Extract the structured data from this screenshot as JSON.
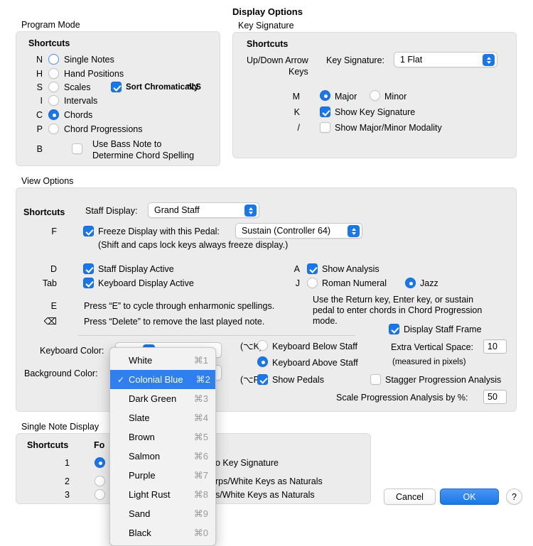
{
  "program_mode": {
    "title": "Program Mode",
    "shortcuts_header": "Shortcuts",
    "options": [
      {
        "key": "N",
        "label": "Single Notes",
        "selected": false
      },
      {
        "key": "H",
        "label": "Hand Positions",
        "selected": false
      },
      {
        "key": "S",
        "label": "Scales",
        "selected": false
      },
      {
        "key": "I",
        "label": "Intervals",
        "selected": false
      },
      {
        "key": "C",
        "label": "Chords",
        "selected": true
      },
      {
        "key": "P",
        "label": "Chord Progressions",
        "selected": false
      }
    ],
    "sort_chromatically": {
      "label": "Sort Chromatically",
      "shortcut": "⌥S",
      "checked": true
    },
    "bass_note": {
      "key": "B",
      "line1": "Use Bass Note to",
      "line2": "Determine Chord Spelling",
      "checked": false
    }
  },
  "display_options": {
    "title": "Display Options",
    "key_signature_group": "Key Signature",
    "shortcuts_header": "Shortcuts",
    "arrow_keys_line1": "Up/Down Arrow",
    "arrow_keys_line2": "Keys",
    "key_signature_label": "Key Signature:",
    "key_signature_value": "1 Flat",
    "modality": {
      "key": "M",
      "major": {
        "label": "Major",
        "selected": true
      },
      "minor": {
        "label": "Minor",
        "selected": false
      }
    },
    "show_key_signature": {
      "key": "K",
      "label": "Show Key Signature",
      "checked": true
    },
    "show_modality": {
      "key": "/",
      "label": "Show Major/Minor Modality",
      "checked": false
    }
  },
  "view_options": {
    "title": "View Options",
    "shortcuts_header": "Shortcuts",
    "staff_display_label": "Staff Display:",
    "staff_display_value": "Grand Staff",
    "freeze": {
      "key": "F",
      "label": "Freeze Display with this Pedal:",
      "checked": true,
      "pedal_value": "Sustain (Controller 64)",
      "note": "(Shift and caps lock keys always freeze display.)"
    },
    "staff_display_active": {
      "key": "D",
      "label": "Staff Display Active",
      "checked": true
    },
    "keyboard_display_active": {
      "key": "Tab",
      "label": "Keyboard Display Active",
      "checked": true
    },
    "enharmonic_hint": {
      "key": "E",
      "text": "Press “E” to cycle through enharmonic spellings."
    },
    "delete_hint": {
      "key": "⌫",
      "text": "Press “Delete” to remove the last played note."
    },
    "show_analysis": {
      "key": "A",
      "label": "Show Analysis",
      "checked": true
    },
    "analysis_style": {
      "key": "J",
      "roman": {
        "label": "Roman Numeral",
        "selected": false
      },
      "jazz": {
        "label": "Jazz",
        "selected": true
      }
    },
    "progression_hint_line1": "Use the Return key, Enter key, or sustain",
    "progression_hint_line2": "pedal to enter chords in Chord Progression",
    "progression_hint_line3": "mode.",
    "display_staff_frame": {
      "label": "Display Staff Frame",
      "checked": true
    },
    "keyboard_color_label": "Keyboard Color:",
    "background_color_label": "Background Color:",
    "keyboard_color_shortcut": "(⌥K)",
    "pedals_shortcut": "(⌥P)",
    "keyboard_below_staff": {
      "label": "Keyboard Below Staff",
      "selected": false
    },
    "keyboard_above_staff": {
      "label": "Keyboard Above Staff",
      "selected": true
    },
    "show_pedals": {
      "label": "Show Pedals",
      "checked": true
    },
    "extra_vertical_space": {
      "label": "Extra Vertical Space:",
      "value": "10",
      "note": "(measured in pixels)"
    },
    "stagger_progression": {
      "label": "Stagger Progression Analysis",
      "checked": false
    },
    "scale_progression": {
      "label": "Scale Progression Analysis by %:",
      "value": "50"
    }
  },
  "color_menu": {
    "items": [
      {
        "label": "White",
        "shortcut": "⌘1",
        "checked": false
      },
      {
        "label": "Colonial Blue",
        "shortcut": "⌘2",
        "checked": true
      },
      {
        "label": "Dark Green",
        "shortcut": "⌘3",
        "checked": false
      },
      {
        "label": "Slate",
        "shortcut": "⌘4",
        "checked": false
      },
      {
        "label": "Brown",
        "shortcut": "⌘5",
        "checked": false
      },
      {
        "label": "Salmon",
        "shortcut": "⌘6",
        "checked": false
      },
      {
        "label": "Purple",
        "shortcut": "⌘7",
        "checked": false
      },
      {
        "label": "Light Rust",
        "shortcut": "⌘8",
        "checked": false
      },
      {
        "label": "Sand",
        "shortcut": "⌘9",
        "checked": false
      },
      {
        "label": "Black",
        "shortcut": "⌘0",
        "checked": false
      }
    ],
    "checkmark": "✓"
  },
  "single_note_display": {
    "title": "Single Note Display",
    "shortcuts_header": "Shortcuts",
    "column_header": "Follow",
    "column_header_visible": "Fo",
    "options": [
      {
        "key": "1",
        "label": "Follow Key Signature",
        "visible_tail": "o Key Signature",
        "selected": true
      },
      {
        "key": "2",
        "label": "Black Keys as Sharps/White Keys as Naturals",
        "visible_tail": "rps/White Keys as Naturals",
        "selected": false
      },
      {
        "key": "3",
        "label": "Black Keys as Flats/White Keys as Naturals",
        "visible_tail": "s/White Keys as Naturals",
        "selected": false
      }
    ]
  },
  "buttons": {
    "cancel": "Cancel",
    "ok": "OK",
    "help": "?"
  },
  "colors": {
    "accent": "#1a77e8",
    "menu_highlight": "#2f7ff0",
    "group_bg": "#ececec",
    "window_bg": "#ffffff"
  }
}
